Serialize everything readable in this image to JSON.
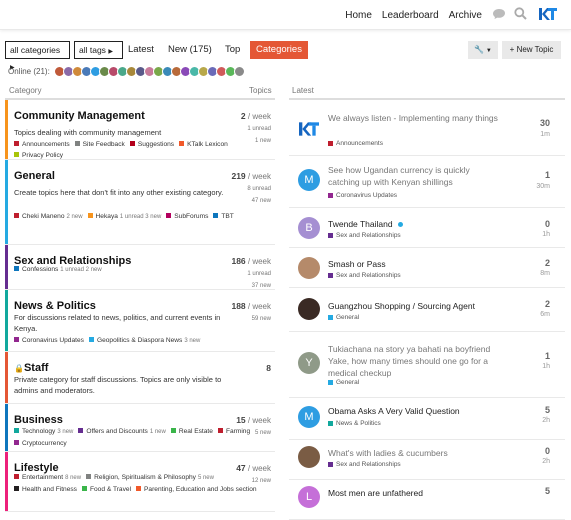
{
  "header": {
    "nav": [
      "Home",
      "Leaderboard",
      "Archive"
    ],
    "logo_text": "KT"
  },
  "toolbar": {
    "all_categories": "all categories",
    "all_tags": "all tags",
    "tabs": [
      "Latest",
      "New (175)",
      "Top",
      "Categories"
    ],
    "new_topic": "New Topic"
  },
  "online": {
    "label": "Online (21):"
  },
  "columns": {
    "category": "Category",
    "topics": "Topics",
    "latest": "Latest"
  },
  "categories": [
    {
      "name": "Community Management",
      "desc": "Topics dealing with community management",
      "color": "#f7941d",
      "subs": [
        [
          "Announcements",
          "#bf1e2e",
          ""
        ],
        [
          "Site Feedback",
          "#808281",
          ""
        ],
        [
          "Suggestions",
          "#b3001b",
          ""
        ],
        [
          "KTalk Lexicon",
          "#f1592a",
          ""
        ],
        [
          "Privacy Policy",
          "#a8c40a",
          ""
        ]
      ],
      "count": "2",
      "period": "/ week",
      "stat1": "1 unread",
      "stat2": "1 new"
    },
    {
      "name": "General",
      "desc": "Create topics here that don't fit into any other existing category.",
      "color": "#25aae2",
      "subs": [
        [
          "Cheki Maneno",
          "#bf1e2e",
          "2 new"
        ],
        [
          "Hekaya",
          "#f7941d",
          "1 unread   3 new"
        ],
        [
          "SubForums",
          "#b3005e",
          ""
        ],
        [
          "TBT",
          "#0e76bd",
          ""
        ]
      ],
      "count": "219",
      "period": "/ week",
      "stat1": "8 unread",
      "stat2": "47 new"
    },
    {
      "name": "Sex and Relationships",
      "desc": "",
      "color": "#652d90",
      "subs": [
        [
          "Confessions",
          "#0e76bd",
          "1 unread   2 new"
        ]
      ],
      "count": "186",
      "period": "/ week",
      "stat1": "1 unread",
      "stat2": "37 new"
    },
    {
      "name": "News & Politics",
      "desc": "For discussions related to news, politics, and current events in Kenya.",
      "color": "#12a89d",
      "subs": [
        [
          "Coronavirus Updates",
          "#92278f",
          ""
        ],
        [
          "Geopolitics & Diaspora News",
          "#25aae2",
          "3 new"
        ]
      ],
      "count": "188",
      "period": "/ week",
      "stat1": "59 new",
      "stat2": ""
    },
    {
      "name": "Staff",
      "desc": "Private category for staff discussions. Topics are only visible to admins and moderators.",
      "color": "#e45735",
      "subs": [],
      "count": "8",
      "period": "",
      "stat1": "",
      "stat2": ""
    },
    {
      "name": "Business",
      "desc": "",
      "color": "#0e76bd",
      "subs": [
        [
          "Technology",
          "#12a89d",
          "3 new"
        ],
        [
          "Offers and Discounts",
          "#652d90",
          "1 new"
        ],
        [
          "Real Estate",
          "#3ab54a",
          ""
        ],
        [
          "Farming",
          "#bf1e2e",
          ""
        ],
        [
          "Cryptocurrency",
          "#92278f",
          ""
        ]
      ],
      "count": "15",
      "period": "/ week",
      "stat1": "5 new",
      "stat2": ""
    },
    {
      "name": "Lifestyle",
      "desc": "",
      "color": "#ed207b",
      "subs": [
        [
          "Entertainment",
          "#bf1e2e",
          "8 new"
        ],
        [
          "Religion, Spiritualism & Philosophy",
          "#808281",
          "5 new"
        ],
        [
          "Health and Fitness",
          "#231f20",
          ""
        ],
        [
          "Food & Travel",
          "#3ab54a",
          ""
        ],
        [
          "Parenting, Education and Jobs section",
          "#f1592a",
          ""
        ]
      ],
      "count": "47",
      "period": "/ week",
      "stat1": "12 new",
      "stat2": ""
    }
  ],
  "topics": [
    {
      "title": "We always listen - Implementing many things",
      "cat": "Announcements",
      "catcolor": "#bf1e2e",
      "replies": "30",
      "age": "1m",
      "avatar": "KT",
      "avbg": "#fff",
      "read": true
    },
    {
      "title": "See how Ugandan currency is quickly catching up with Kenyan shillings",
      "cat": "Coronavirus Updates",
      "catcolor": "#92278f",
      "replies": "1",
      "age": "30m",
      "avatar": "M",
      "avbg": "#2e9de2",
      "read": true
    },
    {
      "title": "Twende Thailand",
      "cat": "Sex and Relationships",
      "catcolor": "#652d90",
      "replies": "0",
      "age": "1h",
      "avatar": "B",
      "avbg": "#a58fd2",
      "read": false
    },
    {
      "title": "Smash or Pass",
      "cat": "Sex and Relationships",
      "catcolor": "#652d90",
      "replies": "2",
      "age": "8m",
      "avatar": "",
      "avbg": "#b58a6a",
      "read": false
    },
    {
      "title": "Guangzhou Shopping / Sourcing Agent",
      "cat": "General",
      "catcolor": "#25aae2",
      "replies": "2",
      "age": "6m",
      "avatar": "",
      "avbg": "#3a2a24",
      "read": false
    },
    {
      "title": "Tukiachana na story ya bahati na boyfriend Yake, how many times should one go for a medical checkup",
      "cat": "General",
      "catcolor": "#25aae2",
      "replies": "1",
      "age": "1h",
      "avatar": "Y",
      "avbg": "#8f9a88",
      "read": true
    },
    {
      "title": "Obama Asks A Very Valid Question",
      "cat": "News & Politics",
      "catcolor": "#12a89d",
      "replies": "5",
      "age": "2h",
      "avatar": "M",
      "avbg": "#2e9de2",
      "read": false
    },
    {
      "title": "What's with ladies & cucumbers",
      "cat": "Sex and Relationships",
      "catcolor": "#652d90",
      "replies": "0",
      "age": "2h",
      "avatar": "",
      "avbg": "#7a5c44",
      "read": true
    },
    {
      "title": "Most men are unfathered",
      "cat": "",
      "catcolor": "#652d90",
      "replies": "5",
      "age": "",
      "avatar": "L",
      "avbg": "#c56fd8",
      "read": false
    }
  ]
}
